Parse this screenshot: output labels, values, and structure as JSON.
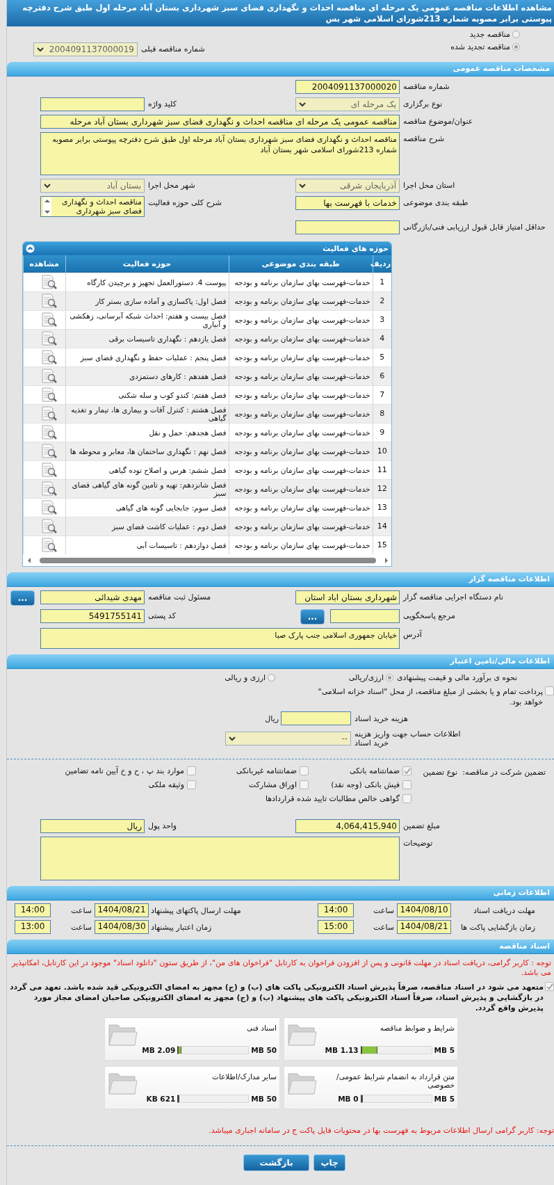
{
  "title": "مشاهده اطلاعات مناقصه عمومی یک مرحله ای مناقصه احداث و نگهداری فضای سبز شهرداری بستان آباد مرحله اول طبق شرح دفترچه پیوستی برابر مصوبه شماره 213شورای اسلامی شهر بس",
  "tender_kind": {
    "options": [
      {
        "label": "مناقصه جدید",
        "selected": false
      },
      {
        "label": "مناقصه تجدید شده",
        "selected": true
      }
    ],
    "previous": {
      "label": "شماره مناقصه قبلی",
      "kind": "select",
      "value": "2004091137000019"
    }
  },
  "general": {
    "header": "مشخصات مناقصه عمومی",
    "rows": [
      [
        {
          "label": "شماره مناقصه",
          "kind": "input",
          "value": "2004091137000020"
        }
      ],
      [
        {
          "label": "نوع برگزاری",
          "kind": "select",
          "value": "یک مرحله ای"
        },
        {
          "label": "کلید واژه",
          "kind": "input"
        }
      ],
      [
        {
          "label": "عنوان/موضوع مناقصه",
          "kind": "wide",
          "value": "مناقصه عمومی یک مرحله ای مناقصه احداث و نگهداری فضای سبز شهرداری بستان آباد مرحله"
        }
      ],
      [
        {
          "label": "شرح مناقصه",
          "kind": "textarea",
          "value": "مناقصه احداث و نگهداری فضای سبز شهرداری بستان آباد مرحله اول طبق شرح دفترچه پیوستی برابر مصوبه شماره 213شورای اسلامی شهر بستان آباد"
        }
      ],
      [
        {
          "label": "استان محل اجرا",
          "kind": "select",
          "value": "آذربایجان شرقی"
        },
        {
          "label": "شهر محل اجرا",
          "kind": "select",
          "value": "بستان آباد"
        }
      ],
      [
        {
          "label": "طبقه بندی موضوعی",
          "kind": "input",
          "value": "خدمات با فهرست بها"
        },
        {
          "label": "شرح کلی حوزه فعالیت",
          "kind": "list",
          "value": "مناقصه احداث و نگهداری فضای سبز شهرداری"
        }
      ],
      [
        {
          "label": "حداقل امتیاز قابل قبول ارزیابی فنی/بازرگانی",
          "kind": "input"
        }
      ]
    ]
  },
  "activities": {
    "header": "حوزه های فعالیت",
    "columns": [
      "ردیف",
      "طبقه بندی موضوعی",
      "حوزه فعالیت",
      "مشاهده"
    ],
    "rows": [
      {
        "num": "1",
        "category": "خدمات-فهرست بهای سازمان برنامه و بودجه",
        "activity": "پیوست 4. دستورالعمل تجهیز و برچیدن کارگاه"
      },
      {
        "num": "2",
        "category": "خدمات-فهرست بهای سازمان برنامه و بودجه",
        "activity": "فصل اول: پاکسازی و آماده سازی بستر کار"
      },
      {
        "num": "3",
        "category": "خدمات-فهرست بهای سازمان برنامه و بودجه",
        "activity": "فصل بیست و هفتم: احداث شبکه آبرسانی، زهکشی و آبیاری"
      },
      {
        "num": "4",
        "category": "خدمات-فهرست بهای سازمان برنامه و بودجه",
        "activity": "فصل یازدهم : نگهداری تاسیسات برقی"
      },
      {
        "num": "5",
        "category": "خدمات-فهرست بهای سازمان برنامه و بودجه",
        "activity": "فصل پنجم : عملیات حفظ و نگهداری فضای سبز"
      },
      {
        "num": "6",
        "category": "خدمات-فهرست بهای سازمان برنامه و بودجه",
        "activity": "فصل هفدهم : کارهای دستمزدی"
      },
      {
        "num": "7",
        "category": "خدمات-فهرست بهای سازمان برنامه و بودجه",
        "activity": "فصل هفتم: کندو کوب و سله شکنی"
      },
      {
        "num": "8",
        "category": "خدمات-فهرست بهای سازمان برنامه و بودجه",
        "activity": "فصل هشتم : کنترل آفات و بیماری ها، تیمار و تغذیه گیاهی"
      },
      {
        "num": "9",
        "category": "خدمات-فهرست بهای سازمان برنامه و بودجه",
        "activity": "فصل هجدهم: حمل و نقل"
      },
      {
        "num": "10",
        "category": "خدمات-فهرست بهای سازمان برنامه و بودجه",
        "activity": "فصل نهم : نگهداری ساختمان ها، معابر و محوطه ها"
      },
      {
        "num": "11",
        "category": "خدمات-فهرست بهای سازمان برنامه و بودجه",
        "activity": "فصل ششم: هرس و اصلاح توده گیاهی"
      },
      {
        "num": "12",
        "category": "خدمات-فهرست بهای سازمان برنامه و بودجه",
        "activity": "فصل شانزدهم: تهیه و تامین گونه های گیاهی فضای سبز"
      },
      {
        "num": "13",
        "category": "خدمات-فهرست بهای سازمان برنامه و بودجه",
        "activity": "فصل سوم: جابجایی گونه های گیاهی"
      },
      {
        "num": "14",
        "category": "خدمات-فهرست بهای سازمان برنامه و بودجه",
        "activity": "فصل دوم : عملیات کاشت فضای سبز"
      },
      {
        "num": "15",
        "category": "خدمات-فهرست بهای سازمان برنامه و بودجه",
        "activity": "فصل دوازدهم : تاسیسات آبی"
      }
    ]
  },
  "organizer": {
    "header": "اطلاعات مناقصه گزار",
    "rows": [
      [
        {
          "label": "نام دستگاه اجرایی مناقصه گزار",
          "kind": "input",
          "value": "شهرداری بستان اباد استان"
        },
        {
          "label": "مسئول ثبت مناقصه",
          "kind": "input",
          "value": "مهدی شیدائی",
          "button": "..."
        }
      ],
      [
        {
          "label": "مرجع پاسخگویی",
          "kind": "input",
          "button": "..."
        },
        {
          "label": "کد پستی",
          "kind": "input",
          "value": "5491755141"
        }
      ],
      [
        {
          "label": "آدرس",
          "kind": "textarea",
          "value": "خیابان جمهوری اسلامی جنب پارک صبا"
        }
      ]
    ]
  },
  "finance": {
    "header": "اطلاعات مالی/تامین اعتبار",
    "estimate": {
      "label": "نحوه ی برآورد مالی و قیمت پیشنهادی",
      "options": [
        {
          "label": "ارزی/ریالی",
          "selected": true
        },
        {
          "label": "ارزی و ریالی",
          "selected": false
        }
      ]
    },
    "treasury": {
      "label": "پرداخت تمام و یا بخشی از مبلغ مناقصه، از محل \"اسناد خزانه اسلامی\" خواهد بود.",
      "checked": false
    },
    "doc_cost": {
      "label": "هزینه خرید اسناد",
      "unit": "ریال"
    },
    "account": {
      "label": "اطلاعات حساب جهت واریز هزینه خرید اسناد",
      "value": "--"
    },
    "guarantee": {
      "label": "تضمین شرکت در مناقصه:",
      "type_label": "نوع تضمین",
      "options": [
        {
          "label": "ضمانتنامه بانکی",
          "checked": true
        },
        {
          "label": "ضمانتنامه غیربانکی",
          "checked": false
        },
        {
          "label": "موارد بند پ ، ح و خ آیین نامه تضامین",
          "checked": false
        },
        {
          "label": "فیش بانکی (وجه نقد)",
          "checked": false
        },
        {
          "label": "اوراق مشارکت",
          "checked": false
        },
        {
          "label": "وثیقه ملکی",
          "checked": false
        },
        {
          "label": "گواهی خالص مطالبات تایید شده قراردادها",
          "checked": false
        }
      ]
    },
    "rows": [
      [
        {
          "label": "مبلغ تضمین",
          "kind": "input",
          "value": "4,064,415,940"
        },
        {
          "label": "واحد پول",
          "kind": "input",
          "value": "ریال"
        }
      ],
      [
        {
          "label": "توضیحات",
          "kind": "textarea"
        }
      ]
    ]
  },
  "timing": {
    "header": "اطلاعات زمانی",
    "items": [
      {
        "label": "مهلت دریافت اسناد",
        "date": "1404/08/10",
        "time_label": "ساعت",
        "time": "14:00"
      },
      {
        "label": "مهلت ارسال پاکتهای پیشنهاد",
        "date": "1404/08/21",
        "time_label": "ساعت",
        "time": "14:00"
      },
      {
        "label": "زمان بازگشایی پاکت ها",
        "date": "1404/08/21",
        "time_label": "ساعت",
        "time": "15:00"
      },
      {
        "label": "زمان اعتبار پیشنهاد",
        "date": "1404/08/30",
        "time_label": "ساعت",
        "time": "13:00"
      }
    ]
  },
  "documents": {
    "header": "اسناد مناقصه",
    "notice": "توجه : کاربر گرامی، دریافت اسناد در مهلت قانونی و پس از افزودن فراخوان به کارتابل \"فراخوان های من\"، از طریق ستون \"دانلود اسناد\" موجود در این کارتابل، امکانپذیر می باشد.",
    "commitment": {
      "label": "متعهد می شود در اسناد مناقصه، صرفاً پذیرش اسناد الکترونیکی پاکت های (ب) و (ج) مجهز به امضای الکترونیکی قید شده باشد. تعهد می گردد در بازگشایی و پذیرش اسناد، صرفاً اسناد الکترونیکی پاکت های پیشنهاد (ب) و (ج) مجهز به امضای الکترونیکی صاحبان امضای مجاز مورد پذیرش واقع گردد.",
      "checked": true
    },
    "files": [
      {
        "name": "شرایط و ضوابط مناقصه",
        "max": "5 MB",
        "size": "1.13 MB",
        "level": 0.226
      },
      {
        "name": "اسناد فنی",
        "max": "50 MB",
        "size": "2.09 MB",
        "level": 0.042
      },
      {
        "name": "متن قرارداد به انضمام شرایط عمومی/خصوصی",
        "max": "5 MB",
        "size": "0 MB",
        "level": 0
      },
      {
        "name": "سایر مدارک/اطلاعات",
        "max": "50 MB",
        "size": "621 KB",
        "level": 0.012
      }
    ],
    "footer_notice": "توجه: کاربر گرامی ارسال اطلاعات مربوط به فهرست بها در محتویات فایل پاکت ج در سامانه اجباری میباشد."
  },
  "buttons": [
    {
      "label": "چاپ"
    },
    {
      "label": "بازگشت"
    }
  ]
}
